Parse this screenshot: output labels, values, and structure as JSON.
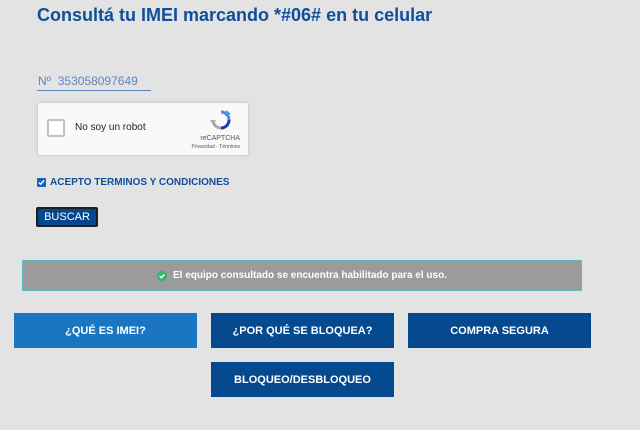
{
  "header": {
    "title": "Consultá tu IMEI marcando *#06# en tu celular"
  },
  "imei_input": {
    "value": "",
    "placeholder": "Nº  353058097649"
  },
  "recaptcha": {
    "label": "No soy un robot",
    "brand": "reCAPTCHA",
    "privacy_link": "Privacidad",
    "separator": " - ",
    "terms_link": "Términos",
    "logo_color": "#1c3aa9"
  },
  "terms": {
    "checked": true,
    "label": "ACEPTO TERMINOS Y CONDICIONES"
  },
  "search_button": {
    "label": "BUSCAR"
  },
  "status": {
    "icon": "check-circle-icon",
    "message": "El equipo consultado se encuentra habilitado para el uso.",
    "icon_color": "#2eb872"
  },
  "actions": {
    "what_is_imei": "¿QUÉ ES IMEI?",
    "why_block": "¿POR QUÉ SE BLOQUEA?",
    "safe_purchase": "COMPRA SEGURA",
    "lock_unlock": "BLOQUEO/DESBLOQUEO"
  },
  "colors": {
    "title": "#0f4f9a",
    "primary_button": "#05498f",
    "light_button": "#1a76c0",
    "background": "#e3e3e3"
  }
}
